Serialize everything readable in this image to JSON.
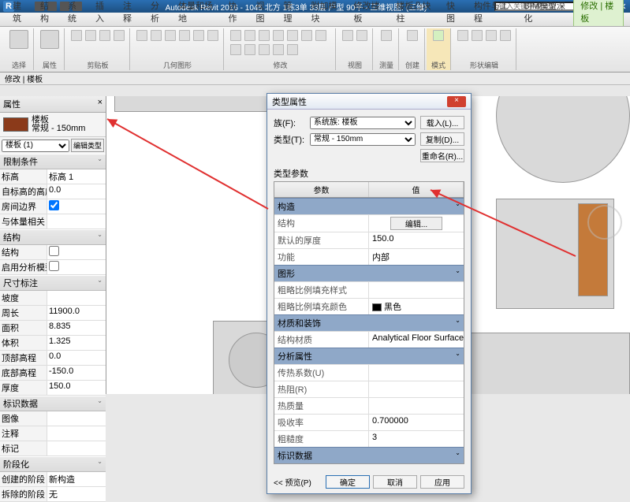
{
  "app": {
    "logo_letter": "R",
    "title": "Autodesk Revit 2016 - 1045 北方 1栋3单 33层 户型 90平 - 三维视图: (三维)",
    "search_placeholder": "键入关键字或短语"
  },
  "ribbon_tabs": [
    "建筑",
    "结构",
    "系统",
    "插入",
    "注释",
    "分析",
    "体量和场地",
    "协作",
    "视图",
    "管理",
    "附加模块",
    "修改楼板",
    "楼板凸块柱",
    "快图",
    "构件与工程",
    "BIM模型深化",
    "修改 | 楼板"
  ],
  "ribbon_active_index": 16,
  "panels": {
    "p0": "选择",
    "p1": "属性",
    "p2": "剪贴板",
    "p3": "几何图形",
    "p4": "修改",
    "p5": "视图",
    "p6": "测量",
    "p7": "创建",
    "p8": "模式",
    "p9": "形状编辑"
  },
  "opt_bar": "修改 | 楼板",
  "props": {
    "header": "属性",
    "close": "×",
    "elem_cat": "楼板",
    "elem_type": "常规 - 150mm",
    "filter": "楼板 (1)",
    "edit_type_btn": "编辑类型",
    "groups": {
      "constraints": "限制条件",
      "structural": "结构",
      "dimensions": "尺寸标注",
      "identity": "标识数据",
      "phasing": "阶段化"
    },
    "rows": {
      "level_k": "标高",
      "level_v": "标高 1",
      "offset_k": "自标高的高度偏移",
      "offset_v": "0.0",
      "room_k": "房间边界",
      "room_v": true,
      "mass_k": "与体量相关",
      "struct_k": "结构",
      "struct_v": false,
      "anal_k": "启用分析模型",
      "anal_v": false,
      "slope_k": "坡度",
      "perim_k": "周长",
      "perim_v": "11900.0",
      "area_k": "面积",
      "area_v": "8.835",
      "vol_k": "体积",
      "vol_v": "1.325",
      "topel_k": "顶部高程",
      "topel_v": "0.0",
      "botel_k": "底部高程",
      "botel_v": "-150.0",
      "thick_k": "厚度",
      "thick_v": "150.0",
      "image_k": "图像",
      "comment_k": "注释",
      "mark_k": "标记",
      "phase_c_k": "创建的阶段",
      "phase_c_v": "新构造",
      "phase_d_k": "拆除的阶段",
      "phase_d_v": "无"
    }
  },
  "dialog": {
    "title": "类型属性",
    "close": "×",
    "family_l": "族(F):",
    "family_v": "系统族: 楼板",
    "load_btn": "载入(L)...",
    "type_l": "类型(T):",
    "type_v": "常规 - 150mm",
    "dup_btn": "复制(D)...",
    "rename_btn": "重命名(R)...",
    "param_hdr": "类型参数",
    "col_param": "参数",
    "col_val": "值",
    "groups": {
      "g_construct": "构造",
      "g_graphics": "图形",
      "g_material": "材质和装饰",
      "g_analytic": "分析属性",
      "g_identity": "标识数据"
    },
    "rows": {
      "structure_k": "结构",
      "structure_btn": "编辑...",
      "thick_k": "默认的厚度",
      "thick_v": "150.0",
      "func_k": "功能",
      "func_v": "内部",
      "coarse_pat_k": "粗略比例填充样式",
      "coarse_col_k": "粗略比例填充颜色",
      "coarse_col_v": "黑色",
      "struct_mat_k": "结构材质",
      "struct_mat_v": "Analytical Floor Surface",
      "heat_k": "传热系数(U)",
      "therm_r_k": "热阻(R)",
      "therm_m_k": "热质量",
      "absorb_k": "吸收率",
      "absorb_v": "0.700000",
      "rough_k": "粗糙度",
      "rough_v": "3"
    },
    "footer": {
      "preview": "<< 预览(P)",
      "ok": "确定",
      "cancel": "取消",
      "apply": "应用"
    }
  }
}
